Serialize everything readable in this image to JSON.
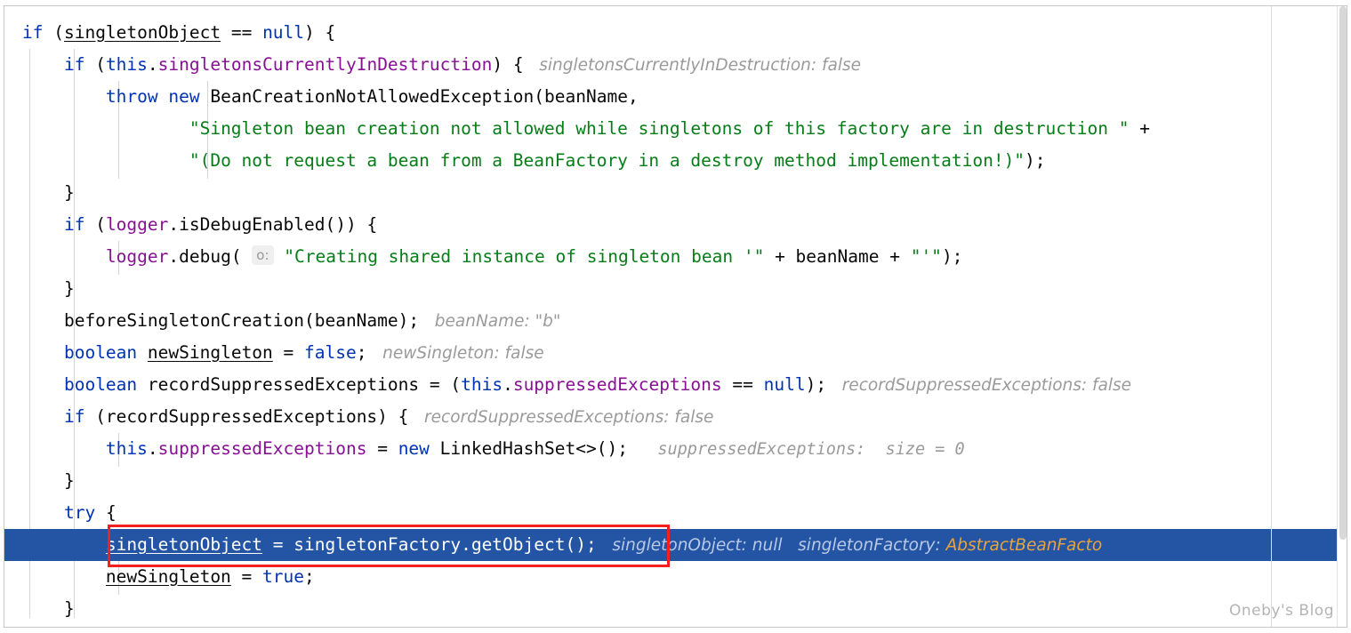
{
  "editor": {
    "language": "java",
    "colors": {
      "keyword": "#0033b3",
      "field": "#871094",
      "string": "#067d17",
      "hint": "#9a9a9a",
      "selection_bg": "#2455a4",
      "selection_fg": "#ffffff",
      "annotation_red": "#f42020",
      "hint_orange": "#e8a33d",
      "background": "#ffffff"
    },
    "watermark": "Oneby's Blog",
    "lines": [
      {
        "n": 1,
        "selected": false,
        "tokens": [
          {
            "t": "if",
            "c": "kw"
          },
          {
            "t": " (",
            "c": "punct"
          },
          {
            "t": "singletonObject",
            "c": "plain under"
          },
          {
            "t": " ",
            "c": "plain"
          },
          {
            "t": "==",
            "c": "plain"
          },
          {
            "t": " ",
            "c": "plain"
          },
          {
            "t": "null",
            "c": "kw"
          },
          {
            "t": ") {",
            "c": "punct"
          }
        ]
      },
      {
        "n": 2,
        "selected": false,
        "tokens": [
          {
            "t": "    ",
            "c": "plain"
          },
          {
            "t": "if",
            "c": "kw"
          },
          {
            "t": " (",
            "c": "punct"
          },
          {
            "t": "this",
            "c": "kw"
          },
          {
            "t": ".",
            "c": "punct"
          },
          {
            "t": "singletonsCurrentlyInDestruction",
            "c": "fld"
          },
          {
            "t": ") {",
            "c": "punct"
          },
          {
            "t": "   singletonsCurrentlyInDestruction: false",
            "c": "hint"
          }
        ]
      },
      {
        "n": 3,
        "selected": false,
        "tokens": [
          {
            "t": "        ",
            "c": "plain"
          },
          {
            "t": "throw",
            "c": "kw"
          },
          {
            "t": " ",
            "c": "plain"
          },
          {
            "t": "new",
            "c": "kw"
          },
          {
            "t": " BeanCreationNotAllowedException(beanName,",
            "c": "plain"
          }
        ]
      },
      {
        "n": 4,
        "selected": false,
        "tokens": [
          {
            "t": "                ",
            "c": "plain"
          },
          {
            "t": "\"Singleton bean creation not allowed while singletons of this factory are in destruction \"",
            "c": "str"
          },
          {
            "t": " +",
            "c": "plain"
          }
        ]
      },
      {
        "n": 5,
        "selected": false,
        "tokens": [
          {
            "t": "                ",
            "c": "plain"
          },
          {
            "t": "\"(Do not request a bean from a BeanFactory in a destroy method implementation!)\"",
            "c": "str"
          },
          {
            "t": ");",
            "c": "punct"
          }
        ]
      },
      {
        "n": 6,
        "selected": false,
        "tokens": [
          {
            "t": "    }",
            "c": "punct"
          }
        ]
      },
      {
        "n": 7,
        "selected": false,
        "tokens": [
          {
            "t": "    ",
            "c": "plain"
          },
          {
            "t": "if",
            "c": "kw"
          },
          {
            "t": " (",
            "c": "punct"
          },
          {
            "t": "logger",
            "c": "fld"
          },
          {
            "t": ".isDebugEnabled()) {",
            "c": "plain"
          }
        ]
      },
      {
        "n": 8,
        "selected": false,
        "badge": "o:",
        "tokens": [
          {
            "t": "        ",
            "c": "plain"
          },
          {
            "t": "logger",
            "c": "fld"
          },
          {
            "t": ".debug( ",
            "c": "plain"
          },
          {
            "t": "__BADGE__",
            "c": "badge"
          },
          {
            "t": "\"Creating shared instance of singleton bean '\"",
            "c": "str"
          },
          {
            "t": " + beanName + ",
            "c": "plain"
          },
          {
            "t": "\"'\"",
            "c": "str"
          },
          {
            "t": ");",
            "c": "punct"
          }
        ]
      },
      {
        "n": 9,
        "selected": false,
        "tokens": [
          {
            "t": "    }",
            "c": "punct"
          }
        ]
      },
      {
        "n": 10,
        "selected": false,
        "tokens": [
          {
            "t": "    beforeSingletonCreation(beanName);",
            "c": "plain"
          },
          {
            "t": "   beanName: \"b\"",
            "c": "hint"
          }
        ]
      },
      {
        "n": 11,
        "selected": false,
        "tokens": [
          {
            "t": "    ",
            "c": "plain"
          },
          {
            "t": "boolean",
            "c": "kw"
          },
          {
            "t": " ",
            "c": "plain"
          },
          {
            "t": "newSingleton",
            "c": "plain under"
          },
          {
            "t": " = ",
            "c": "plain"
          },
          {
            "t": "false",
            "c": "kw"
          },
          {
            "t": ";",
            "c": "punct"
          },
          {
            "t": "   newSingleton: false",
            "c": "hint"
          }
        ]
      },
      {
        "n": 12,
        "selected": false,
        "tokens": [
          {
            "t": "    ",
            "c": "plain"
          },
          {
            "t": "boolean",
            "c": "kw"
          },
          {
            "t": " recordSuppressedExceptions = (",
            "c": "plain"
          },
          {
            "t": "this",
            "c": "kw"
          },
          {
            "t": ".",
            "c": "punct"
          },
          {
            "t": "suppressedExceptions",
            "c": "fld"
          },
          {
            "t": " == ",
            "c": "plain"
          },
          {
            "t": "null",
            "c": "kw"
          },
          {
            "t": ");",
            "c": "punct"
          },
          {
            "t": "   recordSuppressedExceptions: false",
            "c": "hint"
          }
        ]
      },
      {
        "n": 13,
        "selected": false,
        "tokens": [
          {
            "t": "    ",
            "c": "plain"
          },
          {
            "t": "if",
            "c": "kw"
          },
          {
            "t": " (recordSuppressedExceptions) {",
            "c": "plain"
          },
          {
            "t": "   recordSuppressedExceptions: false",
            "c": "hint"
          }
        ]
      },
      {
        "n": 14,
        "selected": false,
        "tokens": [
          {
            "t": "        ",
            "c": "plain"
          },
          {
            "t": "this",
            "c": "kw"
          },
          {
            "t": ".",
            "c": "punct"
          },
          {
            "t": "suppressedExceptions",
            "c": "fld"
          },
          {
            "t": " = ",
            "c": "plain"
          },
          {
            "t": "new",
            "c": "kw"
          },
          {
            "t": " LinkedHashSet<>();",
            "c": "plain"
          },
          {
            "t": "   suppressedExceptions:  size = 0",
            "c": "hint-mono"
          }
        ]
      },
      {
        "n": 15,
        "selected": false,
        "tokens": [
          {
            "t": "    }",
            "c": "punct"
          }
        ]
      },
      {
        "n": 16,
        "selected": false,
        "tokens": [
          {
            "t": "    ",
            "c": "plain"
          },
          {
            "t": "try",
            "c": "kw"
          },
          {
            "t": " {",
            "c": "punct"
          }
        ]
      },
      {
        "n": 17,
        "selected": true,
        "tokens": [
          {
            "t": "        ",
            "c": "plain"
          },
          {
            "t": "singletonObject",
            "c": "plain under"
          },
          {
            "t": " = singletonFactory.getObject();",
            "c": "plain"
          },
          {
            "t": "   singletonObject: null   singletonFactory: ",
            "c": "hint"
          },
          {
            "t": "AbstractBeanFacto",
            "c": "hint-orange"
          }
        ]
      },
      {
        "n": 18,
        "selected": false,
        "tokens": [
          {
            "t": "        ",
            "c": "plain"
          },
          {
            "t": "newSingleton",
            "c": "plain under"
          },
          {
            "t": " = ",
            "c": "plain"
          },
          {
            "t": "true",
            "c": "kw"
          },
          {
            "t": ";",
            "c": "punct"
          }
        ]
      },
      {
        "n": 19,
        "selected": false,
        "tokens": [
          {
            "t": "    }",
            "c": "punct"
          }
        ]
      }
    ],
    "annotation": {
      "type": "red-rectangle",
      "target_line": 17,
      "target_text": "singletonObject = singletonFactory.getObject();"
    }
  }
}
